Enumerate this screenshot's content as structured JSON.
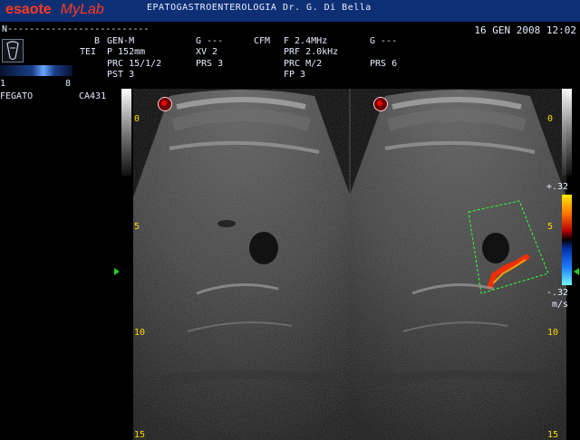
{
  "topbar": {
    "logo_mark": "esaote",
    "logo_word": "MyLab",
    "department_and_doctor": "EPATOGASTROENTEROLOGIA Dr. G. Di Bella"
  },
  "patient_line": "N--------------------------",
  "datetime": "16 GEN 2008 12:02",
  "left_panel": {
    "gray_scale_min": "1",
    "gray_scale_max": "8",
    "organ": "FEGATO",
    "probe": "CA431"
  },
  "params": {
    "col1": {
      "line1": "B",
      "line2": "TEI"
    },
    "col2": {
      "line1": "GEN-M",
      "line2": "P 152mm",
      "line3": "PRC 15/1/2",
      "line4": "PST  3"
    },
    "col3": {
      "line1": "G ---",
      "line2": "XV 2",
      "line3": "PRS  3"
    },
    "col4": {
      "line1": "CFM",
      "line2": ""
    },
    "col5": {
      "line1": "F  2.4MHz",
      "line2": "PRF 2.0kHz",
      "line3": "PRC M/2",
      "line4": "FP  3"
    },
    "col6": {
      "line1": "G ---",
      "line2": "",
      "line3": "PRS  6"
    }
  },
  "depth_left": [
    "0",
    "5",
    "10",
    "15"
  ],
  "depth_right": [
    "0",
    "5",
    "10",
    "15"
  ],
  "color_scale": {
    "top": "+.32",
    "bottom": "-.32",
    "unit": "m/s"
  },
  "colors": {
    "topbar": "#0f2f75",
    "accent": "#ff3b1f",
    "depth": "#ffd400",
    "marker": "#20d020"
  }
}
